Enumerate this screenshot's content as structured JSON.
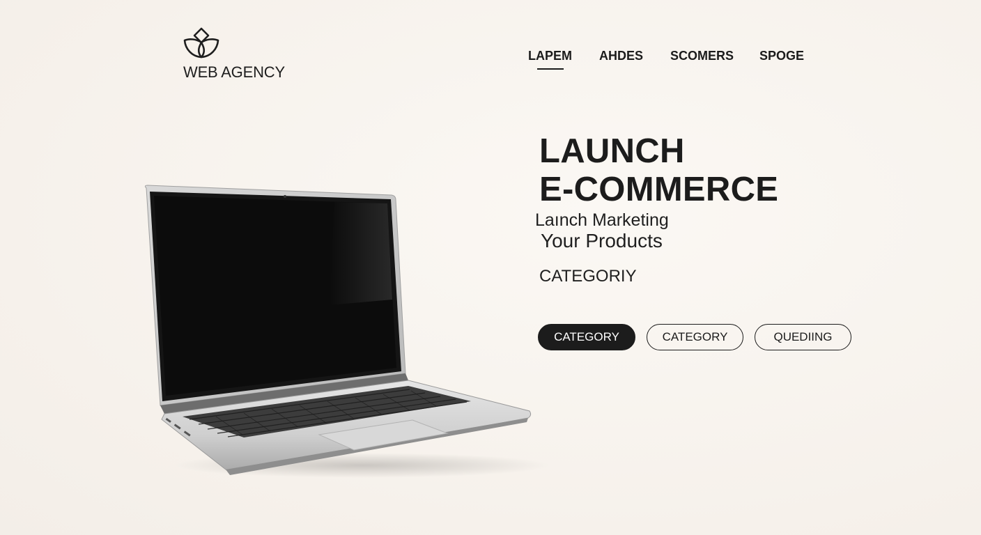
{
  "brand": {
    "name": "WEB AGENCY",
    "logo_icon": "lotus-logo-icon"
  },
  "nav": {
    "items": [
      {
        "label": "LAPEM",
        "active": true
      },
      {
        "label": "AHDES",
        "active": false
      },
      {
        "label": "SCOMERS",
        "active": false
      },
      {
        "label": "SPOGE",
        "active": false
      }
    ]
  },
  "hero": {
    "title_line1": "LAUNCH",
    "title_line2": "E-COMMERCE",
    "subtitle_line1": "Laınch Marketing",
    "subtitle_line2": "Your Products",
    "category_label": "CATEGORIY"
  },
  "pills": [
    {
      "label": "CATEGORY",
      "style": "filled"
    },
    {
      "label": "CATEGORY",
      "style": "outline"
    },
    {
      "label": "QUEDIING",
      "style": "outline"
    }
  ],
  "colors": {
    "background": "#f8f4ef",
    "text": "#1b1b1b",
    "pill_filled": "#1c1c1c"
  },
  "illustration": {
    "type": "laptop-illustration"
  }
}
